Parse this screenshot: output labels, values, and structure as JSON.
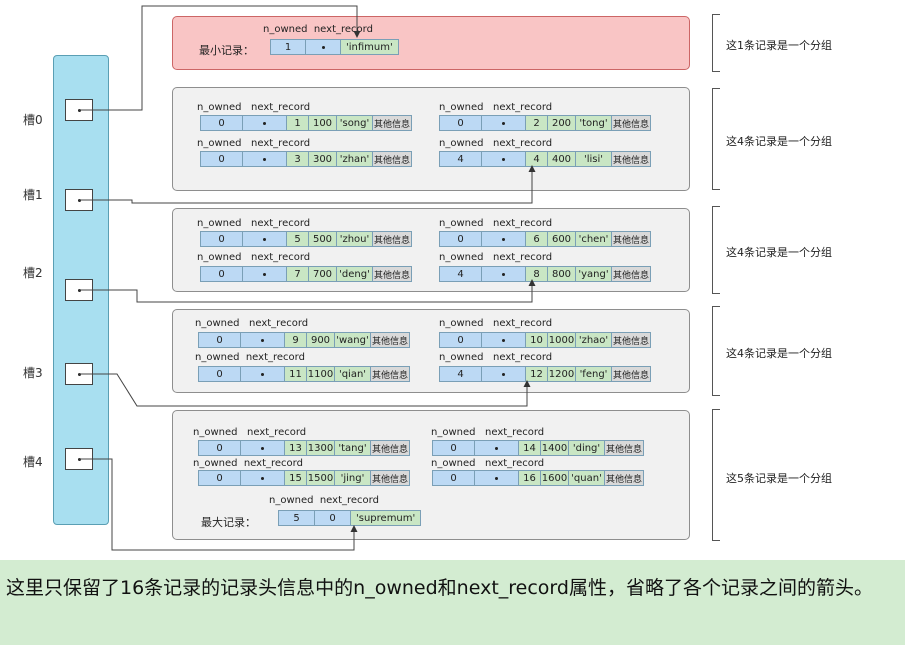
{
  "header_labels": {
    "n_owned": "n_owned",
    "next_record": "next_record"
  },
  "other_info_label": "其他信息",
  "infimum": {
    "label": "最小记录：",
    "n_owned": "1",
    "name": "'infimum'"
  },
  "supremum": {
    "label": "最大记录：",
    "n_owned": "5",
    "next": "0",
    "name": "'supremum'"
  },
  "slots": [
    "槽0",
    "槽1",
    "槽2",
    "槽3",
    "槽4"
  ],
  "records": [
    {
      "n_owned": "0",
      "num": "1",
      "id": "100",
      "name": "'song'"
    },
    {
      "n_owned": "0",
      "num": "2",
      "id": "200",
      "name": "'tong'"
    },
    {
      "n_owned": "0",
      "num": "3",
      "id": "300",
      "name": "'zhan'"
    },
    {
      "n_owned": "4",
      "num": "4",
      "id": "400",
      "name": "'lisi'"
    },
    {
      "n_owned": "0",
      "num": "5",
      "id": "500",
      "name": "'zhou'"
    },
    {
      "n_owned": "0",
      "num": "6",
      "id": "600",
      "name": "'chen'"
    },
    {
      "n_owned": "0",
      "num": "7",
      "id": "700",
      "name": "'deng'"
    },
    {
      "n_owned": "4",
      "num": "8",
      "id": "800",
      "name": "'yang'"
    },
    {
      "n_owned": "0",
      "num": "9",
      "id": "900",
      "name": "'wang'"
    },
    {
      "n_owned": "0",
      "num": "10",
      "id": "1000",
      "name": "'zhao'"
    },
    {
      "n_owned": "0",
      "num": "11",
      "id": "1100",
      "name": "'qian'"
    },
    {
      "n_owned": "4",
      "num": "12",
      "id": "1200",
      "name": "'feng'"
    },
    {
      "n_owned": "0",
      "num": "13",
      "id": "1300",
      "name": "'tang'"
    },
    {
      "n_owned": "0",
      "num": "14",
      "id": "1400",
      "name": "'ding'"
    },
    {
      "n_owned": "0",
      "num": "15",
      "id": "1500",
      "name": "'jing'"
    },
    {
      "n_owned": "0",
      "num": "16",
      "id": "1600",
      "name": "'quan'"
    }
  ],
  "group_notes": [
    "这1条记录是一个分组",
    "这4条记录是一个分组",
    "这4条记录是一个分组",
    "这4条记录是一个分组",
    "这5条记录是一个分组"
  ],
  "caption": "这里只保留了16条记录的记录头信息中的n_owned和next_record属性，省略了各个记录之间的箭头。"
}
